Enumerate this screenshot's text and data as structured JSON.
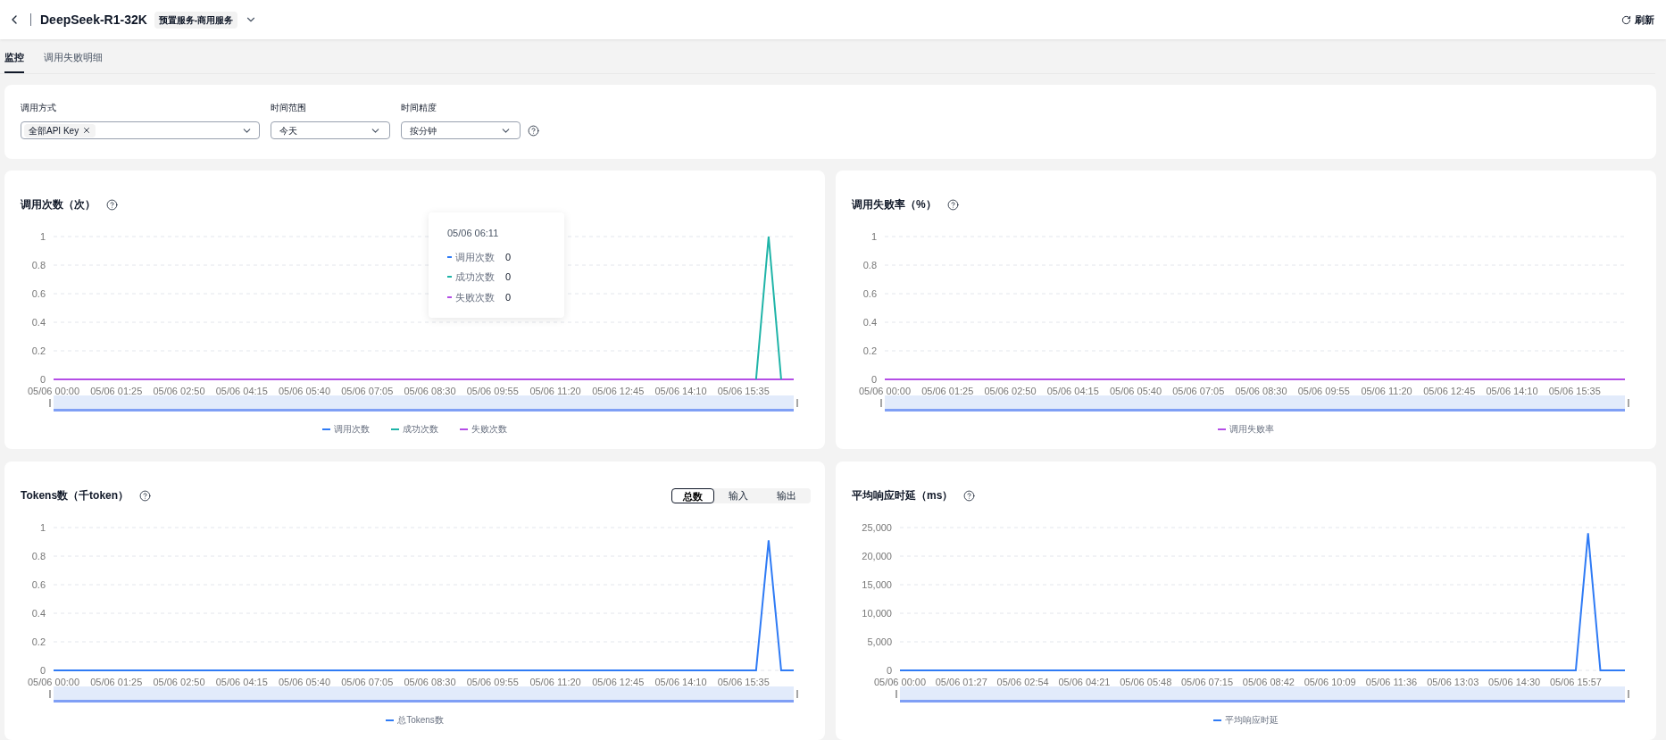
{
  "header": {
    "title": "DeepSeek-R1-32K",
    "tag": "预置服务-商用服务",
    "refresh": "刷新"
  },
  "tabs": [
    {
      "label": "监控",
      "selected": true
    },
    {
      "label": "调用失败明细",
      "selected": false
    }
  ],
  "filters": [
    {
      "label": "调用方式",
      "kind": "tags",
      "tags": [
        "全部API Key"
      ]
    },
    {
      "label": "时间范围",
      "kind": "select",
      "value": "今天"
    },
    {
      "label": "时间精度",
      "kind": "select",
      "value": "按分钟",
      "help": true
    }
  ],
  "charts": [
    {
      "title": "调用次数（次）",
      "help": true,
      "tooltip": {
        "title": "05/06 06:11",
        "rows": [
          {
            "name": "调用次数",
            "value": "0",
            "color": "#2f7bf5"
          },
          {
            "name": "成功次数",
            "value": "0",
            "color": "#1fb4a8"
          },
          {
            "name": "失败次数",
            "value": "0",
            "color": "#b44ee6"
          }
        ]
      },
      "chart_data": {
        "type": "line",
        "grid": true,
        "legend": "bottom",
        "ylim": [
          0,
          1
        ],
        "yticks": [
          0,
          0.2,
          0.4,
          0.6,
          0.8,
          1
        ],
        "categories": [
          "05/06 00:00",
          null,
          null,
          null,
          null,
          "05/06 01:25",
          null,
          null,
          null,
          null,
          "05/06 02:50",
          null,
          null,
          null,
          null,
          "05/06 04:15",
          null,
          null,
          null,
          null,
          "05/06 05:40",
          null,
          null,
          null,
          null,
          "05/06 07:05",
          null,
          null,
          null,
          null,
          "05/06 08:30",
          null,
          null,
          null,
          null,
          "05/06 09:55",
          null,
          null,
          null,
          null,
          "05/06 11:20",
          null,
          null,
          null,
          null,
          "05/06 12:45",
          null,
          null,
          null,
          null,
          "05/06 14:10",
          null,
          null,
          null,
          null,
          "05/06 15:35",
          null,
          null,
          null,
          null
        ],
        "series": [
          {
            "name": "调用次数",
            "color": "#2f7bf5",
            "values": [
              null,
              null,
              null,
              null,
              null,
              null,
              null,
              null,
              null,
              null,
              null,
              null,
              null,
              null,
              null,
              null,
              null,
              null,
              null,
              null,
              null,
              null,
              null,
              null,
              null,
              null,
              null,
              null,
              null,
              null,
              null,
              null,
              null,
              null,
              null,
              null,
              null,
              null,
              null,
              null,
              null,
              null,
              null,
              null,
              null,
              null,
              null,
              null,
              null,
              null,
              null,
              null,
              null,
              null,
              null,
              null,
              null,
              null,
              null,
              null
            ]
          },
          {
            "name": "成功次数",
            "color": "#1fb4a8",
            "values": [
              null,
              null,
              null,
              null,
              null,
              null,
              null,
              null,
              null,
              null,
              null,
              null,
              null,
              null,
              null,
              null,
              null,
              null,
              null,
              null,
              null,
              null,
              null,
              null,
              null,
              null,
              null,
              null,
              null,
              null,
              null,
              null,
              null,
              null,
              null,
              null,
              null,
              null,
              null,
              null,
              null,
              null,
              null,
              null,
              null,
              null,
              null,
              null,
              null,
              null,
              null,
              null,
              null,
              null,
              null,
              null,
              0,
              1,
              0,
              null
            ]
          },
          {
            "name": "失败次数",
            "color": "#b44ee6",
            "values": [
              0,
              0,
              0,
              0,
              0,
              0,
              0,
              0,
              0,
              0,
              0,
              0,
              0,
              0,
              0,
              0,
              0,
              0,
              0,
              0,
              0,
              0,
              0,
              0,
              0,
              0,
              0,
              0,
              0,
              0,
              0,
              0,
              0,
              0,
              0,
              0,
              0,
              0,
              0,
              0,
              0,
              0,
              0,
              0,
              0,
              0,
              0,
              0,
              0,
              0,
              0,
              0,
              0,
              0,
              0,
              0,
              0,
              0,
              0,
              0
            ]
          }
        ]
      }
    },
    {
      "title": "调用失败率（%）",
      "help": true,
      "chart_data": {
        "type": "line",
        "grid": true,
        "legend": "bottom",
        "ylim": [
          0,
          1
        ],
        "yticks": [
          0,
          0.2,
          0.4,
          0.6,
          0.8,
          1
        ],
        "categories": [
          "05/06 00:00",
          null,
          null,
          null,
          null,
          "05/06 01:25",
          null,
          null,
          null,
          null,
          "05/06 02:50",
          null,
          null,
          null,
          null,
          "05/06 04:15",
          null,
          null,
          null,
          null,
          "05/06 05:40",
          null,
          null,
          null,
          null,
          "05/06 07:05",
          null,
          null,
          null,
          null,
          "05/06 08:30",
          null,
          null,
          null,
          null,
          "05/06 09:55",
          null,
          null,
          null,
          null,
          "05/06 11:20",
          null,
          null,
          null,
          null,
          "05/06 12:45",
          null,
          null,
          null,
          null,
          "05/06 14:10",
          null,
          null,
          null,
          null,
          "05/06 15:35",
          null,
          null,
          null,
          null
        ],
        "series": [
          {
            "name": "调用失败率",
            "color": "#b44ee6",
            "values": [
              0,
              0,
              0,
              0,
              0,
              0,
              0,
              0,
              0,
              0,
              0,
              0,
              0,
              0,
              0,
              0,
              0,
              0,
              0,
              0,
              0,
              0,
              0,
              0,
              0,
              0,
              0,
              0,
              0,
              0,
              0,
              0,
              0,
              0,
              0,
              0,
              0,
              0,
              0,
              0,
              0,
              0,
              0,
              0,
              0,
              0,
              0,
              0,
              0,
              0,
              0,
              0,
              0,
              0,
              0,
              0,
              0,
              0,
              0,
              0
            ]
          }
        ]
      }
    },
    {
      "title": "Tokens数（千token）",
      "help": true,
      "segments": [
        {
          "label": "总数",
          "selected": true
        },
        {
          "label": "输入",
          "selected": false
        },
        {
          "label": "输出",
          "selected": false
        }
      ],
      "chart_data": {
        "type": "line",
        "grid": true,
        "legend": "bottom",
        "ylim": [
          0,
          1
        ],
        "yticks": [
          0,
          0.2,
          0.4,
          0.6,
          0.8,
          1
        ],
        "categories": [
          "05/06 00:00",
          null,
          null,
          null,
          null,
          "05/06 01:25",
          null,
          null,
          null,
          null,
          "05/06 02:50",
          null,
          null,
          null,
          null,
          "05/06 04:15",
          null,
          null,
          null,
          null,
          "05/06 05:40",
          null,
          null,
          null,
          null,
          "05/06 07:05",
          null,
          null,
          null,
          null,
          "05/06 08:30",
          null,
          null,
          null,
          null,
          "05/06 09:55",
          null,
          null,
          null,
          null,
          "05/06 11:20",
          null,
          null,
          null,
          null,
          "05/06 12:45",
          null,
          null,
          null,
          null,
          "05/06 14:10",
          null,
          null,
          null,
          null,
          "05/06 15:35",
          null,
          null,
          null,
          null
        ],
        "series": [
          {
            "name": "总Tokens数",
            "color": "#2f7bf5",
            "values": [
              0,
              0,
              0,
              0,
              0,
              0,
              0,
              0,
              0,
              0,
              0,
              0,
              0,
              0,
              0,
              0,
              0,
              0,
              0,
              0,
              0,
              0,
              0,
              0,
              0,
              0,
              0,
              0,
              0,
              0,
              0,
              0,
              0,
              0,
              0,
              0,
              0,
              0,
              0,
              0,
              0,
              0,
              0,
              0,
              0,
              0,
              0,
              0,
              0,
              0,
              0,
              0,
              0,
              0,
              0,
              0,
              0,
              0.91,
              0,
              0
            ]
          }
        ]
      }
    },
    {
      "title": "平均响应时延（ms）",
      "help": true,
      "chart_data": {
        "type": "line",
        "grid": true,
        "legend": "bottom",
        "ylim": [
          0,
          25000
        ],
        "yticks": [
          {
            "value": 0,
            "label": "0"
          },
          {
            "value": 5000,
            "label": "5,000"
          },
          {
            "value": 10000,
            "label": "10,000"
          },
          {
            "value": 15000,
            "label": "15,000"
          },
          {
            "value": 20000,
            "label": "20,000"
          },
          {
            "value": 25000,
            "label": "25,000"
          }
        ],
        "categories": [
          "05/06 00:00",
          null,
          null,
          null,
          null,
          "05/06 01:27",
          null,
          null,
          null,
          null,
          "05/06 02:54",
          null,
          null,
          null,
          null,
          "05/06 04:21",
          null,
          null,
          null,
          null,
          "05/06 05:48",
          null,
          null,
          null,
          null,
          "05/06 07:15",
          null,
          null,
          null,
          null,
          "05/06 08:42",
          null,
          null,
          null,
          null,
          "05/06 10:09",
          null,
          null,
          null,
          null,
          "05/06 11:36",
          null,
          null,
          null,
          null,
          "05/06 13:03",
          null,
          null,
          null,
          null,
          "05/06 14:30",
          null,
          null,
          null,
          null,
          "05/06 15:57",
          null,
          null,
          null,
          null
        ],
        "series": [
          {
            "name": "平均响应时延",
            "color": "#2f7bf5",
            "values": [
              0,
              0,
              0,
              0,
              0,
              0,
              0,
              0,
              0,
              0,
              0,
              0,
              0,
              0,
              0,
              0,
              0,
              0,
              0,
              0,
              0,
              0,
              0,
              0,
              0,
              0,
              0,
              0,
              0,
              0,
              0,
              0,
              0,
              0,
              0,
              0,
              0,
              0,
              0,
              0,
              0,
              0,
              0,
              0,
              0,
              0,
              0,
              0,
              0,
              0,
              0,
              0,
              0,
              0,
              0,
              0,
              24000,
              0,
              0,
              0
            ]
          }
        ]
      }
    }
  ]
}
